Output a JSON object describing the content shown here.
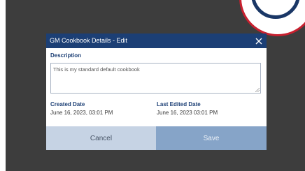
{
  "dialog": {
    "title": "GM Cookbook Details - Edit",
    "close_icon": "close-icon",
    "description_label": "Description",
    "description_value": "This is my standard default cookbook",
    "created_date_label": "Created Date",
    "created_date_value": "June 16, 2023, 03:01 PM",
    "last_edited_label": "Last Edited Date",
    "last_edited_value": "June 16, 2023 03:01 PM",
    "cancel_label": "Cancel",
    "save_label": "Save"
  },
  "colors": {
    "header": "#1c3f75",
    "backdrop": "#3d3d3d",
    "cancel_button": "#c6d3e4",
    "save_button": "#86a4c8",
    "badge_border": "#c8202f"
  }
}
